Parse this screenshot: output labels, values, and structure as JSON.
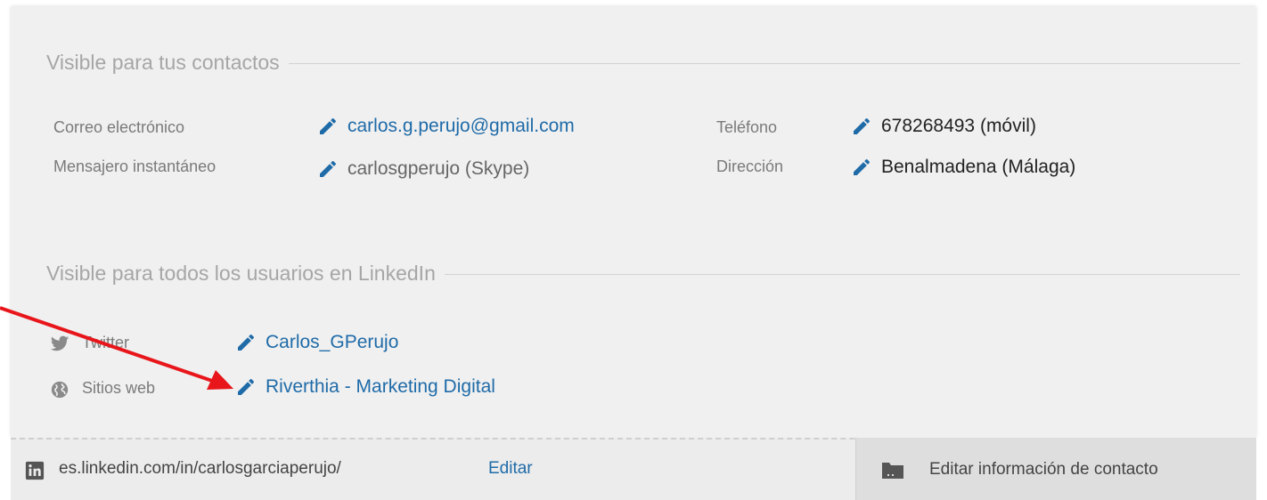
{
  "contacts_section": {
    "title": "Visible para tus contactos",
    "email": {
      "label": "Correo electrónico",
      "value": "carlos.g.perujo@gmail.com"
    },
    "im": {
      "label": "Mensajero instantáneo",
      "value": "carlosgperujo (Skype)"
    },
    "phone": {
      "label": "Teléfono",
      "value": "678268493 (móvil)"
    },
    "address": {
      "label": "Dirección",
      "value": "Benalmadena (Málaga)"
    }
  },
  "public_section": {
    "title": "Visible para todos los usuarios en LinkedIn",
    "twitter": {
      "label": "Twitter",
      "value": "Carlos_GPerujo"
    },
    "websites": {
      "label": "Sitios web",
      "value": "Riverthia - Marketing Digital"
    }
  },
  "footer": {
    "profile_url": "es.linkedin.com/in/carlosgarciaperujo/",
    "edit_label": "Editar",
    "edit_contact_label": "Editar información de contacto"
  },
  "colors": {
    "link_blue": "#1f6ba8",
    "pencil_blue": "#1f6ba8",
    "annotation_arrow": "#e8161b",
    "panel_bg": "#f0f0f0"
  },
  "icons": {
    "edit": "pencil-icon",
    "twitter": "twitter-bird-icon",
    "websites": "globe-icon",
    "linkedin": "linkedin-icon",
    "contact_card": "briefcase-icon"
  }
}
